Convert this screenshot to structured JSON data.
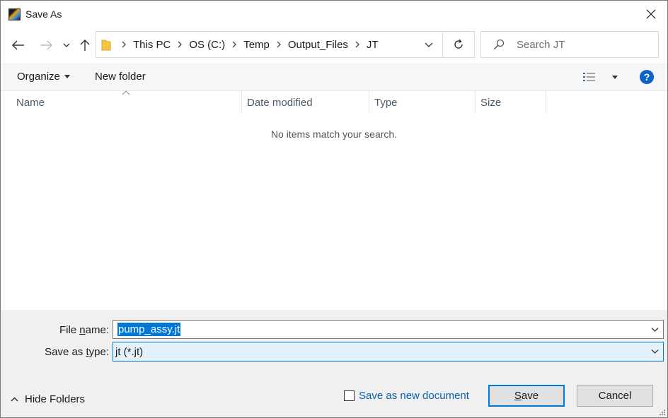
{
  "window": {
    "title": "Save As"
  },
  "nav": {
    "breadcrumbs": [
      "This PC",
      "OS (C:)",
      "Temp",
      "Output_Files",
      "JT"
    ]
  },
  "search": {
    "placeholder": "Search JT"
  },
  "toolbar": {
    "organize_label": "Organize",
    "new_folder_label": "New folder",
    "help_label": "?"
  },
  "columns": [
    "Name",
    "Date modified",
    "Type",
    "Size"
  ],
  "file_list": {
    "empty_message": "No items match your search."
  },
  "form": {
    "file_name_label_pre": "File ",
    "file_name_label_key": "n",
    "file_name_label_post": "ame:",
    "file_name_value": "pump_assy.jt",
    "save_type_label_pre": "Save as ",
    "save_type_label_key": "t",
    "save_type_label_post": "ype:",
    "save_type_value": "jt (*.jt)"
  },
  "footer": {
    "hide_folders_label": "Hide Folders",
    "save_as_new_label": "Save as new document",
    "save_as_new_checked": false,
    "save_label_key": "S",
    "save_label_rest": "ave",
    "cancel_label": "Cancel"
  },
  "colors": {
    "accent": "#0078d7",
    "help": "#0a64c8",
    "link": "#0a5fb4"
  }
}
